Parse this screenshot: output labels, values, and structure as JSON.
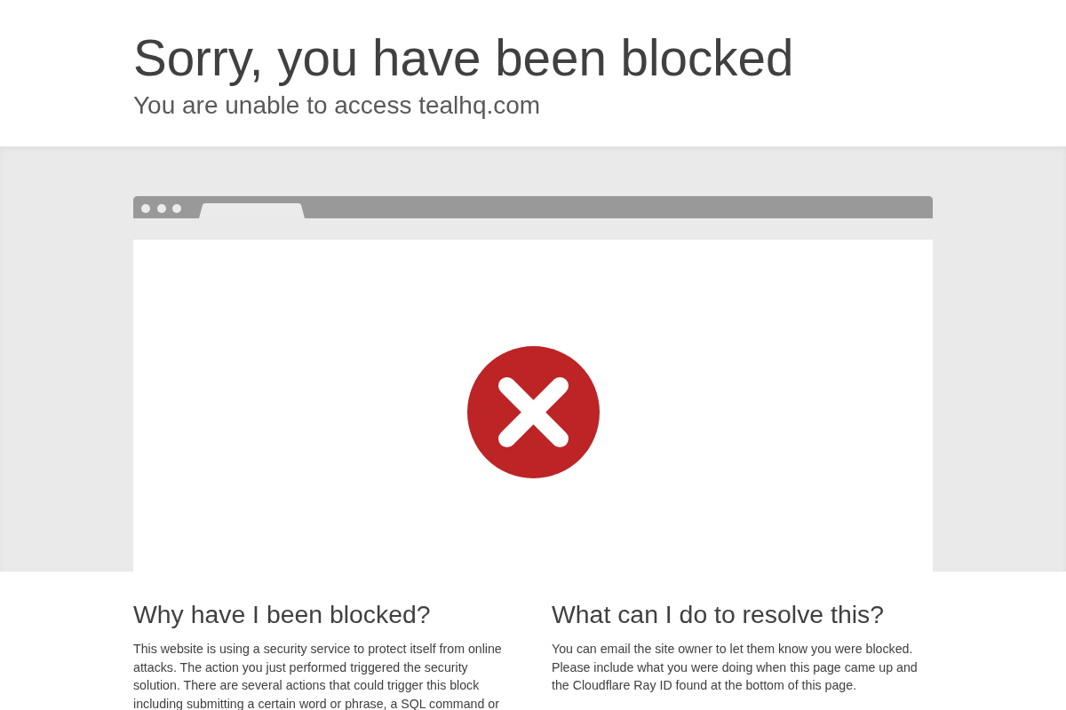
{
  "header": {
    "title": "Sorry, you have been blocked",
    "subtitle": "You are unable to access tealhq.com"
  },
  "sections": [
    {
      "heading": "Why have I been blocked?",
      "text": "This website is using a security service to protect itself from online attacks. The action you just performed triggered the security solution. There are several actions that could trigger this block including submitting a certain word or phrase, a SQL command or"
    },
    {
      "heading": "What can I do to resolve this?",
      "text": "You can email the site owner to let them know you were blocked. Please include what you were doing when this page came up and the Cloudflare Ray ID found at the bottom of this page."
    }
  ]
}
